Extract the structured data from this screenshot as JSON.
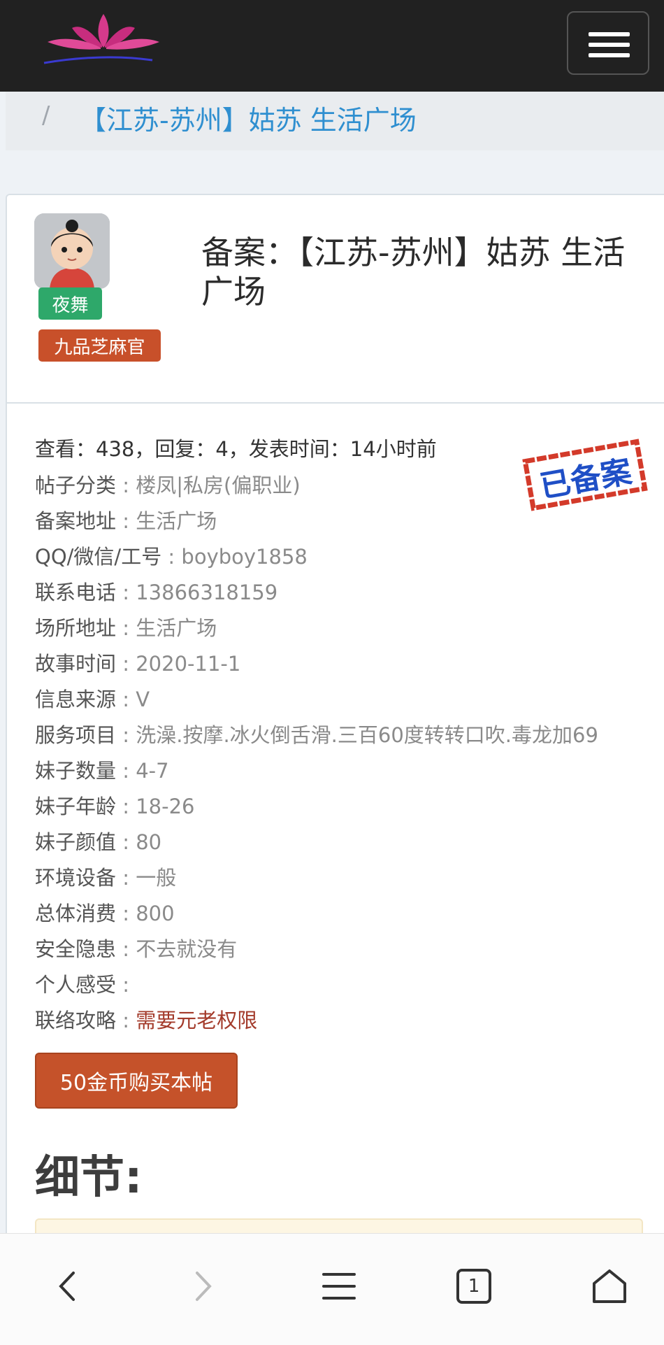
{
  "breadcrumb": {
    "separator": "/",
    "current": "【江苏-苏州】姑苏 生活广场"
  },
  "post": {
    "title": "备案：【江苏-苏州】姑苏 生活广场",
    "author_tag": "夜舞",
    "rank": "九品芝麻官",
    "stats": "查看：438，回复：4，发表时间：14小时前",
    "stamp_text": "已备案",
    "fields": [
      {
        "label": "帖子分类",
        "value": "楼凤|私房(偏职业)"
      },
      {
        "label": "备案地址",
        "value": "生活广场"
      },
      {
        "label": "QQ/微信/工号",
        "value": "boyboy1858"
      },
      {
        "label": "联系电话",
        "value": "13866318159"
      },
      {
        "label": "场所地址",
        "value": "生活广场"
      },
      {
        "label": "故事时间",
        "value": "2020-11-1"
      },
      {
        "label": "信息来源",
        "value": "V"
      },
      {
        "label": "服务项目",
        "value": "洗澡.按摩.冰火倒舌滑.三百60度转转口吹.毒龙加69"
      },
      {
        "label": "妹子数量",
        "value": "4-7"
      },
      {
        "label": "妹子年龄",
        "value": "18-26"
      },
      {
        "label": "妹子颜值",
        "value": "80"
      },
      {
        "label": "环境设备",
        "value": "一般"
      },
      {
        "label": "总体消费",
        "value": "800"
      },
      {
        "label": "安全隐患",
        "value": "不去就没有"
      },
      {
        "label": "个人感受",
        "value": ""
      },
      {
        "label": "联络攻略",
        "value": "需要元老权限"
      }
    ],
    "field_separator": " : ",
    "buy_button": "50金币购买本帖",
    "section_title": "细节:"
  },
  "bottom_nav": {
    "tab_count": "1"
  },
  "colors": {
    "navbar": "#212121",
    "link": "#2f8fd0",
    "badge_green": "#2ea86a",
    "accent": "#c5522a",
    "stamp": "#d33a2a",
    "stamp_text": "#1f4fc6"
  }
}
